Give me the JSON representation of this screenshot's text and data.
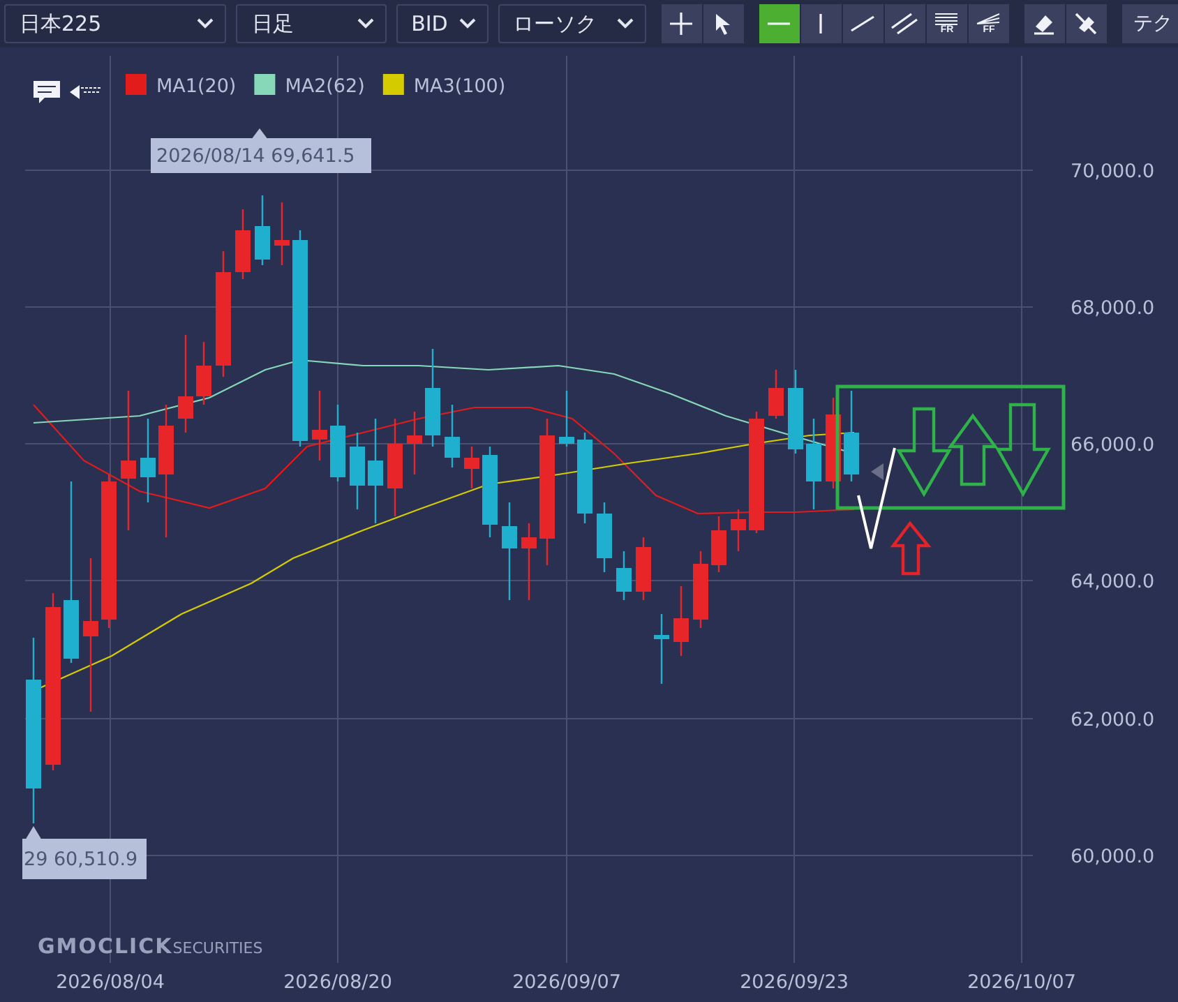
{
  "toolbar": {
    "selects": [
      {
        "value": "日本225"
      },
      {
        "value": "日足"
      },
      {
        "value": "BID"
      },
      {
        "value": "ローソク"
      }
    ],
    "tool_groups": [
      [
        {
          "kind": "crosshair",
          "selected": false
        },
        {
          "kind": "cursor",
          "selected": false
        }
      ],
      [
        {
          "kind": "hline",
          "selected": true
        },
        {
          "kind": "vline",
          "selected": false
        },
        {
          "kind": "trendline",
          "selected": false
        },
        {
          "kind": "parallel",
          "selected": false
        },
        {
          "kind": "fib",
          "label": "FR",
          "selected": false
        },
        {
          "kind": "fan",
          "label": "FF",
          "selected": false
        }
      ],
      [
        {
          "kind": "eraser",
          "selected": false
        },
        {
          "kind": "hide",
          "selected": false
        }
      ]
    ],
    "cut_button": {
      "label": "テク"
    }
  },
  "chart": {
    "legend": [
      {
        "label": "MA1(20)",
        "color": "#e21b1b"
      },
      {
        "label": "MA2(62)",
        "color": "#86d8b8"
      },
      {
        "label": "MA3(100)",
        "color": "#d4cc00"
      }
    ],
    "y_axis": [
      "70,000.0",
      "68,000.0",
      "66,000.0",
      "64,000.0",
      "62,000.0",
      "60,000.0"
    ],
    "x_axis": [
      "2026/08/04",
      "2026/08/20",
      "2026/09/07",
      "2026/09/23",
      "2026/10/07"
    ],
    "high_marker": "2026/08/14 69,641.5",
    "low_marker": "29 60,510.9",
    "logo": {
      "brand": "GMOCLICK",
      "suffix": "SECURITIES"
    }
  }
}
